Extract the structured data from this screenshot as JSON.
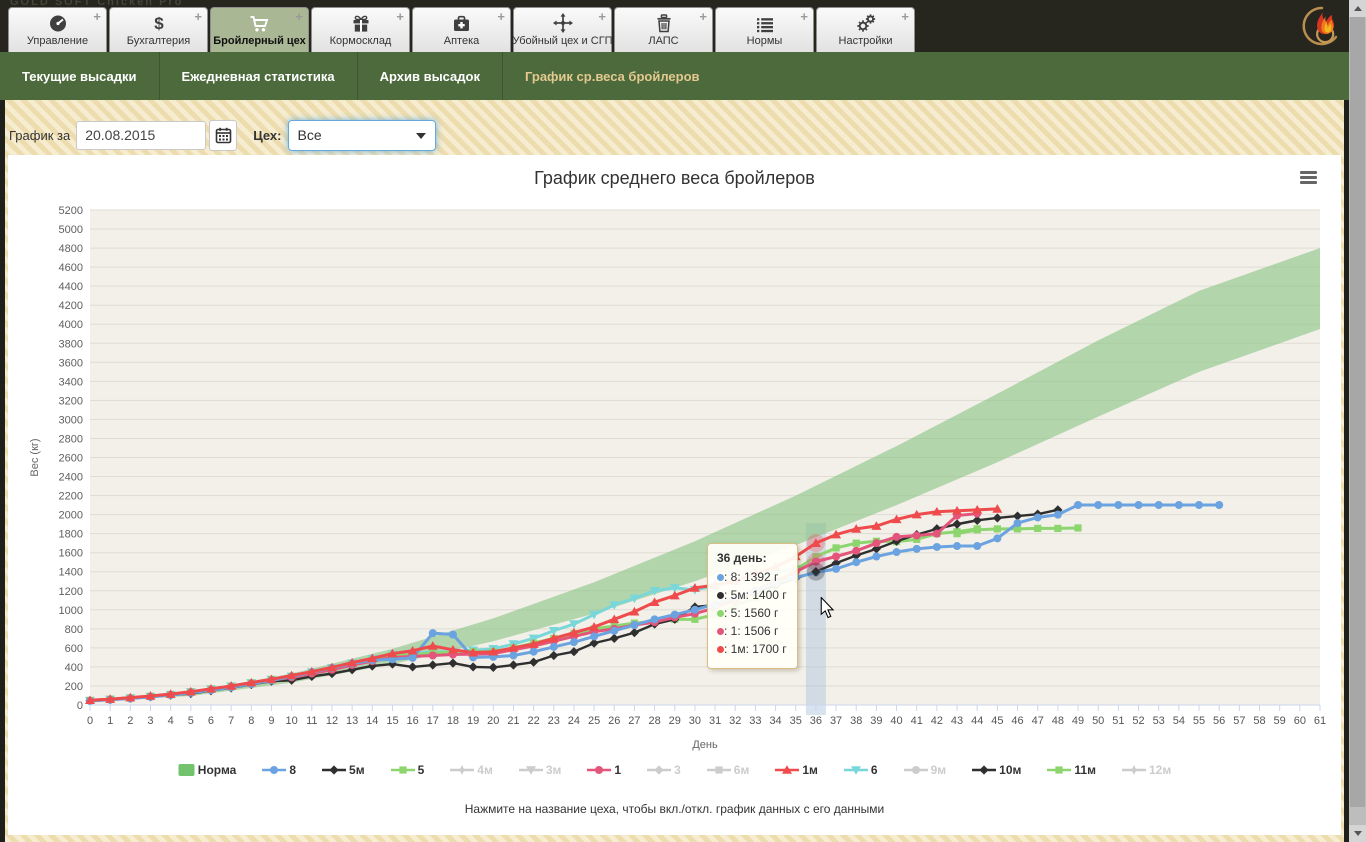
{
  "topbar": {
    "brand": "GOLD SOFT Chicken Pro",
    "plus_label": "+",
    "tabs": [
      {
        "label": "Управление",
        "icon": "gauge-icon",
        "active": false
      },
      {
        "label": "Бухгалтерия",
        "icon": "dollar-icon",
        "active": false
      },
      {
        "label": "Бройлерный цех",
        "icon": "cart-icon",
        "active": true
      },
      {
        "label": "Кормосклад",
        "icon": "gift-icon",
        "active": false
      },
      {
        "label": "Аптека",
        "icon": "medkit-icon",
        "active": false
      },
      {
        "label": "Убойный цех и СГП",
        "icon": "move-icon",
        "active": false
      },
      {
        "label": "ЛАПС",
        "icon": "trash-icon",
        "active": false
      },
      {
        "label": "Нормы",
        "icon": "list-icon",
        "active": false
      },
      {
        "label": "Настройки",
        "icon": "gears-icon",
        "active": false
      }
    ]
  },
  "subnav": {
    "items": [
      {
        "label": "Текущие высадки",
        "active": false
      },
      {
        "label": "Ежедневная статистика",
        "active": false
      },
      {
        "label": "Архив высадок",
        "active": false
      },
      {
        "label": "График ср.веса бройлеров",
        "active": true
      }
    ],
    "active_color": "#e3c98f"
  },
  "filter": {
    "date_label": "График за",
    "date_value": "20.08.2015",
    "calendar_icon": "calendar-icon",
    "shop_label": "Цех:",
    "shop_value": "Все"
  },
  "chart": {
    "title": "График среднего веса бройлеров",
    "footer_hint": "Нажмите на название цеха, чтобы вкл./откл. график данных с его данными",
    "export_icon": "hamburger-menu-icon"
  },
  "chart_data": {
    "type": "line",
    "title": "График среднего веса бройлеров",
    "xlabel": "День",
    "ylabel": "Вес (кг)",
    "xlim": [
      0,
      61
    ],
    "ylim": [
      0,
      5200
    ],
    "ytick": 200,
    "xtick": 1,
    "grid": "horizontal",
    "legend_position": "bottom",
    "plot_bg": "#f2f0e9",
    "grid_color": "#dedcd3",
    "axis_line_color": "#ccd6eb",
    "norm_band": {
      "name": "Норма",
      "fill": "rgba(135,195,130,0.6)",
      "days": [
        0,
        5,
        10,
        15,
        20,
        25,
        30,
        35,
        40,
        45,
        50,
        55,
        61
      ],
      "low": [
        40,
        95,
        235,
        430,
        670,
        960,
        1300,
        1680,
        2100,
        2550,
        3030,
        3500,
        3950
      ],
      "high": [
        55,
        135,
        330,
        590,
        910,
        1290,
        1720,
        2200,
        2720,
        3270,
        3830,
        4350,
        4800
      ]
    },
    "series": [
      {
        "name": "6",
        "color": "#7AD7D9",
        "marker": "triangle-down",
        "start_day": 0,
        "values": [
          45,
          58,
          72,
          88,
          108,
          138,
          168,
          198,
          232,
          268,
          300,
          345,
          390,
          440,
          485,
          530,
          545,
          555,
          560,
          575,
          590,
          640,
          700,
          780,
          850,
          950,
          1050,
          1120,
          1200,
          1230,
          1210,
          1250,
          1300,
          1350,
          1390,
          1430
        ]
      },
      {
        "name": "5",
        "color": "#8CD56F",
        "marker": "square",
        "start_day": 0,
        "values": [
          48,
          60,
          75,
          92,
          110,
          135,
          165,
          195,
          230,
          268,
          300,
          340,
          385,
          430,
          470,
          520,
          530,
          545,
          555,
          560,
          560,
          600,
          650,
          700,
          750,
          800,
          830,
          860,
          880,
          900,
          900,
          950,
          1050,
          1120,
          1260,
          1420,
          1560,
          1650,
          1700,
          1720,
          1716,
          1740,
          1800,
          1820,
          1850
        ]
      },
      {
        "name": "11м",
        "color": "#8CD56F",
        "marker": "square",
        "start_day": 43,
        "values": [
          1800,
          1840,
          1850,
          1850,
          1855,
          1855,
          1860
        ]
      },
      {
        "name": "5м",
        "color": "#2F2F2F",
        "marker": "diamond",
        "start_day": 0,
        "values": [
          45,
          56,
          70,
          86,
          104,
          120,
          150,
          180,
          215,
          250,
          260,
          300,
          330,
          370,
          410,
          430,
          400,
          420,
          440,
          400,
          395,
          420,
          450,
          520,
          560,
          650,
          700,
          760,
          850,
          900,
          1030,
          1050,
          1100,
          1180,
          1260,
          1330,
          1400,
          1490,
          1570,
          1640,
          1720,
          1790,
          1850,
          1900,
          1940
        ]
      },
      {
        "name": "10м",
        "color": "#2F2F2F",
        "marker": "diamond",
        "start_day": 42,
        "values": [
          1850,
          1900,
          1940,
          1965,
          1985,
          2005,
          2050
        ]
      },
      {
        "name": "1",
        "color": "#E4557B",
        "marker": "circle",
        "start_day": 0,
        "values": [
          45,
          57,
          70,
          87,
          106,
          132,
          160,
          190,
          225,
          260,
          290,
          330,
          370,
          420,
          460,
          500,
          510,
          520,
          530,
          535,
          540,
          580,
          620,
          670,
          720,
          770,
          800,
          840,
          870,
          920,
          960,
          1020,
          1100,
          1200,
          1300,
          1400,
          1506,
          1560,
          1620,
          1700,
          1766,
          1780,
          1800,
          1990,
          2010
        ]
      },
      {
        "name": "8",
        "color": "#6BA3E0",
        "marker": "circle",
        "start_day": 0,
        "values": [
          42,
          55,
          68,
          85,
          105,
          128,
          155,
          185,
          220,
          258,
          300,
          345,
          390,
          435,
          470,
          480,
          495,
          755,
          740,
          500,
          505,
          520,
          560,
          610,
          660,
          720,
          780,
          840,
          900,
          950,
          1000,
          1060,
          1130,
          1200,
          1280,
          1340,
          1392,
          1430,
          1500,
          1560,
          1607,
          1640,
          1660,
          1670,
          1670,
          1750,
          1911,
          1970,
          2000,
          2101,
          2101,
          2101,
          2101,
          2101,
          2101,
          2101,
          2101
        ]
      },
      {
        "name": "1м",
        "color": "#EF4B4C",
        "marker": "triangle",
        "start_day": 0,
        "values": [
          50,
          62,
          78,
          95,
          115,
          140,
          170,
          200,
          235,
          270,
          310,
          350,
          395,
          445,
          490,
          540,
          570,
          620,
          580,
          550,
          560,
          600,
          640,
          700,
          760,
          820,
          900,
          980,
          1080,
          1150,
          1230,
          1260,
          1300,
          1380,
          1450,
          1560,
          1700,
          1790,
          1850,
          1880,
          1950,
          2000,
          2030,
          2040,
          2050,
          2060
        ]
      }
    ],
    "legend": [
      {
        "label": "Норма",
        "marker": "band",
        "color": "#72c26e",
        "enabled": true
      },
      {
        "label": "8",
        "marker": "circle",
        "color": "#6BA3E0",
        "enabled": true
      },
      {
        "label": "5м",
        "marker": "diamond",
        "color": "#2F2F2F",
        "enabled": true
      },
      {
        "label": "5",
        "marker": "square",
        "color": "#8CD56F",
        "enabled": true
      },
      {
        "label": "4м",
        "marker": "star",
        "color": "#cccccc",
        "enabled": false
      },
      {
        "label": "3м",
        "marker": "triangle-down",
        "color": "#cccccc",
        "enabled": false
      },
      {
        "label": "1",
        "marker": "circle",
        "color": "#E4557B",
        "enabled": true
      },
      {
        "label": "3",
        "marker": "diamond",
        "color": "#cccccc",
        "enabled": false
      },
      {
        "label": "6м",
        "marker": "square",
        "color": "#cccccc",
        "enabled": false
      },
      {
        "label": "1м",
        "marker": "triangle",
        "color": "#EF4B4C",
        "enabled": true
      },
      {
        "label": "6",
        "marker": "triangle-down",
        "color": "#7AD7D9",
        "enabled": true
      },
      {
        "label": "9м",
        "marker": "circle",
        "color": "#cccccc",
        "enabled": false
      },
      {
        "label": "10м",
        "marker": "diamond",
        "color": "#2F2F2F",
        "enabled": true
      },
      {
        "label": "11м",
        "marker": "square",
        "color": "#8CD56F",
        "enabled": true
      },
      {
        "label": "12м",
        "marker": "star",
        "color": "#cccccc",
        "enabled": false
      }
    ],
    "hover": {
      "day": 36,
      "highlight": [
        "1м",
        "1",
        "5м"
      ],
      "crosshair_color": "rgba(170,190,220,0.45)"
    }
  },
  "tooltip": {
    "header": "36 день:",
    "rows": [
      {
        "color": "#6BA3E0",
        "text": ": 8: 1392 г"
      },
      {
        "color": "#2F2F2F",
        "text": ": 5м: 1400 г"
      },
      {
        "color": "#8CD56F",
        "text": ": 5: 1560 г"
      },
      {
        "color": "#E4557B",
        "text": ": 1: 1506 г"
      },
      {
        "color": "#EF4B4C",
        "text": ": 1м: 1700 г"
      }
    ]
  },
  "colors": {
    "topbar_bg": "#26261f",
    "active_tab_bg": "#a9b795",
    "subnav_bg": "#4d6a3d",
    "stripe_light": "#f6ecd0",
    "stripe_dark": "#eddcae"
  }
}
